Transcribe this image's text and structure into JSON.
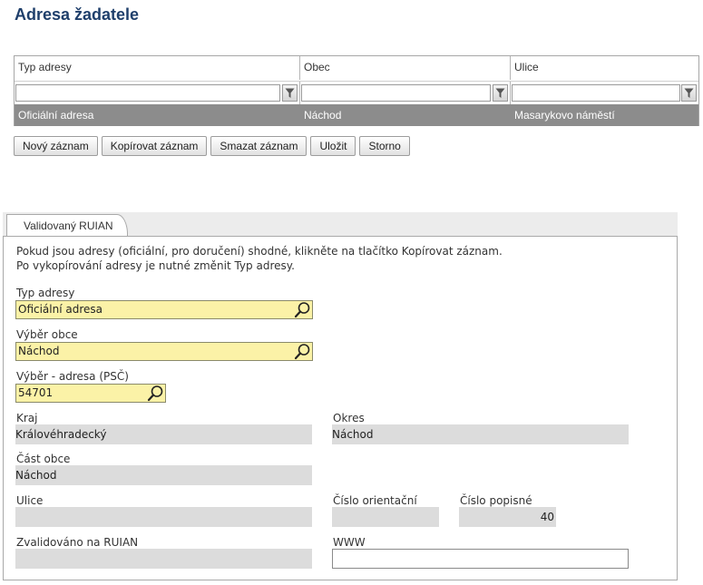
{
  "page": {
    "title": "Adresa žadatele"
  },
  "grid": {
    "columns": [
      "Typ adresy",
      "Obec",
      "Ulice"
    ],
    "rows": [
      {
        "typ_adresy": "Oficiální adresa",
        "obec": "Náchod",
        "ulice": "Masarykovo náměstí"
      }
    ]
  },
  "toolbar": {
    "new_label": "Nový záznam",
    "copy_label": "Kopírovat záznam",
    "delete_label": "Smazat záznam",
    "save_label": "Uložit",
    "cancel_label": "Storno"
  },
  "tabs": [
    {
      "label": "Validovaný RUIAN"
    }
  ],
  "form": {
    "info_line1": "Pokud jsou adresy (oficiální, pro doručení) shodné, klikněte na tlačítko Kopírovat záznam.",
    "info_line2": "Po vykopírování adresy je nutné změnit Typ adresy.",
    "typ_adresy": {
      "label": "Typ adresy",
      "value": "Oficiální adresa"
    },
    "vyber_obce": {
      "label": "Výběr obce",
      "value": "Náchod"
    },
    "vyber_adresa": {
      "label": "Výběr - adresa (PSČ)",
      "value": "54701"
    },
    "kraj": {
      "label": "Kraj",
      "value": "Královéhradecký"
    },
    "okres": {
      "label": "Okres",
      "value": "Náchod"
    },
    "cast_obce": {
      "label": "Část obce",
      "value": "Náchod"
    },
    "ulice": {
      "label": "Ulice",
      "value": ""
    },
    "cislo_orientacni": {
      "label": "Číslo orientační",
      "value": ""
    },
    "cislo_popisne": {
      "label": "Číslo popisné",
      "value": "40"
    },
    "zvalidovano": {
      "label": "Zvalidováno na RUIAN",
      "value": ""
    },
    "www": {
      "label": "WWW",
      "value": ""
    }
  },
  "icons": {
    "filter": "filter-icon",
    "lookup": "magnifier-icon"
  },
  "colors": {
    "title": "#1f3f6b",
    "lookup_bg": "#fbf2a7",
    "readonly_bg": "#dcdcdc",
    "selected_row": "#8c8c8c"
  }
}
